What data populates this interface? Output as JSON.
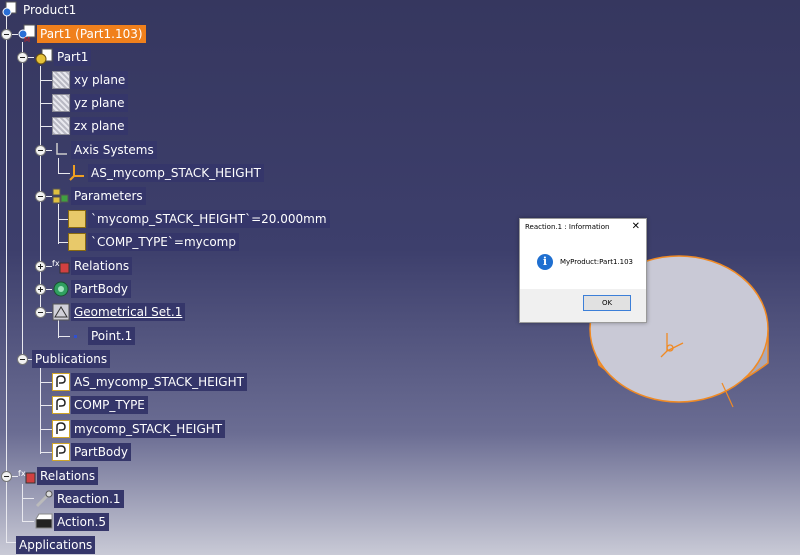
{
  "tree": {
    "product": "Product1",
    "part_instance": "Part1 (Part1.103)",
    "part": "Part1",
    "xy_plane": "xy plane",
    "yz_plane": "yz plane",
    "zx_plane": "zx plane",
    "axis_systems": "Axis Systems",
    "axis_item": "AS_mycomp_STACK_HEIGHT",
    "parameters": "Parameters",
    "param_height": "`mycomp_STACK_HEIGHT`=20.000mm",
    "param_type": "`COMP_TYPE`=mycomp",
    "relations_part": "Relations",
    "partbody": "PartBody",
    "geoset": "Geometrical Set.1",
    "point": "Point.1",
    "publications": "Publications",
    "pubs": [
      "AS_mycomp_STACK_HEIGHT",
      "COMP_TYPE",
      "mycomp_STACK_HEIGHT",
      "PartBody"
    ],
    "relations": "Relations",
    "reaction": "Reaction.1",
    "action": "Action.5",
    "applications": "Applications"
  },
  "dialog": {
    "title": "Reaction.1 : Information",
    "close": "✕",
    "message": "MyProduct:Part1.103",
    "ok": "OK",
    "icon": "info-icon"
  },
  "colors": {
    "selection": "#f0801c",
    "label_bg": "#35366a",
    "part_edge": "#f08a24",
    "part_fill": "#c9c9d6"
  }
}
